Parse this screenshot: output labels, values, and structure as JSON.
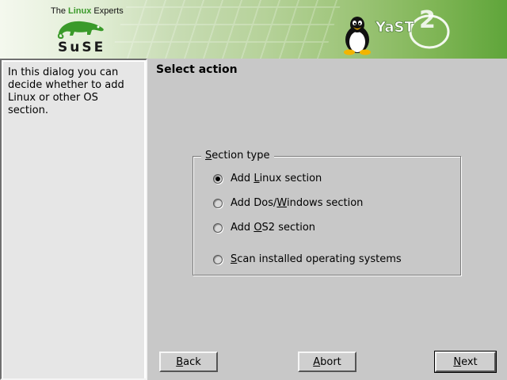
{
  "header": {
    "tagline_pre": "The ",
    "tagline_highlight": "Linux",
    "tagline_post": " Experts",
    "vendor_logo_text": "SuSE",
    "product_logo_text": "YaST",
    "product_logo_version": "2"
  },
  "help": {
    "text": "In this dialog you can decide whether to add Linux or other OS section."
  },
  "main": {
    "title": "Select action",
    "group": {
      "title_underlined": "S",
      "title_rest": "ection type",
      "options": [
        {
          "pre": "Add ",
          "u": "L",
          "post": "inux section",
          "selected": true
        },
        {
          "pre": "Add Dos/",
          "u": "W",
          "post": "indows section",
          "selected": false
        },
        {
          "pre": "Add ",
          "u": "O",
          "post": "S2 section",
          "selected": false
        },
        {
          "pre": "",
          "u": "S",
          "post": "can installed operating systems",
          "selected": false
        }
      ]
    }
  },
  "buttons": {
    "back": {
      "u": "B",
      "rest": "ack"
    },
    "abort": {
      "u": "A",
      "rest": "bort"
    },
    "next": {
      "u": "N",
      "rest": "ext"
    }
  },
  "colors": {
    "accent_green": "#3a9a2a",
    "background": "#c8c8c8"
  }
}
